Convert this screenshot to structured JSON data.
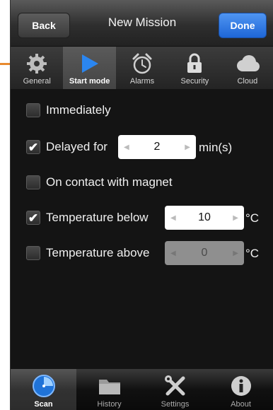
{
  "navbar": {
    "back_label": "Back",
    "title": "New Mission",
    "done_label": "Done"
  },
  "top_tabs": [
    {
      "label": "General",
      "icon": "gear-icon",
      "active": false
    },
    {
      "label": "Start mode",
      "icon": "play-icon",
      "active": true
    },
    {
      "label": "Alarms",
      "icon": "alarm-clock-icon",
      "active": false
    },
    {
      "label": "Security",
      "icon": "lock-icon",
      "active": false
    },
    {
      "label": "Cloud",
      "icon": "cloud-icon",
      "active": false
    }
  ],
  "options": {
    "immediately": {
      "label": "Immediately",
      "checked": false
    },
    "delayed": {
      "label": "Delayed for",
      "checked": true,
      "value": "2",
      "unit": "min(s)"
    },
    "magnet": {
      "label": "On contact with magnet",
      "checked": false
    },
    "temp_below": {
      "label": "Temperature below",
      "checked": true,
      "value": "10",
      "unit": "°C"
    },
    "temp_above": {
      "label": "Temperature above",
      "checked": false,
      "value": "0",
      "unit": "°C"
    }
  },
  "check_glyph": "✔",
  "stepper_left": "◀",
  "stepper_right": "▶",
  "bottom_tabs": [
    {
      "label": "Scan",
      "icon": "scan-icon",
      "active": true
    },
    {
      "label": "History",
      "icon": "folder-icon",
      "active": false
    },
    {
      "label": "Settings",
      "icon": "tools-icon",
      "active": false
    },
    {
      "label": "About",
      "icon": "info-icon",
      "active": false
    }
  ],
  "colors": {
    "accent_blue": "#1e66d6",
    "callout_orange": "#e88a2e"
  }
}
